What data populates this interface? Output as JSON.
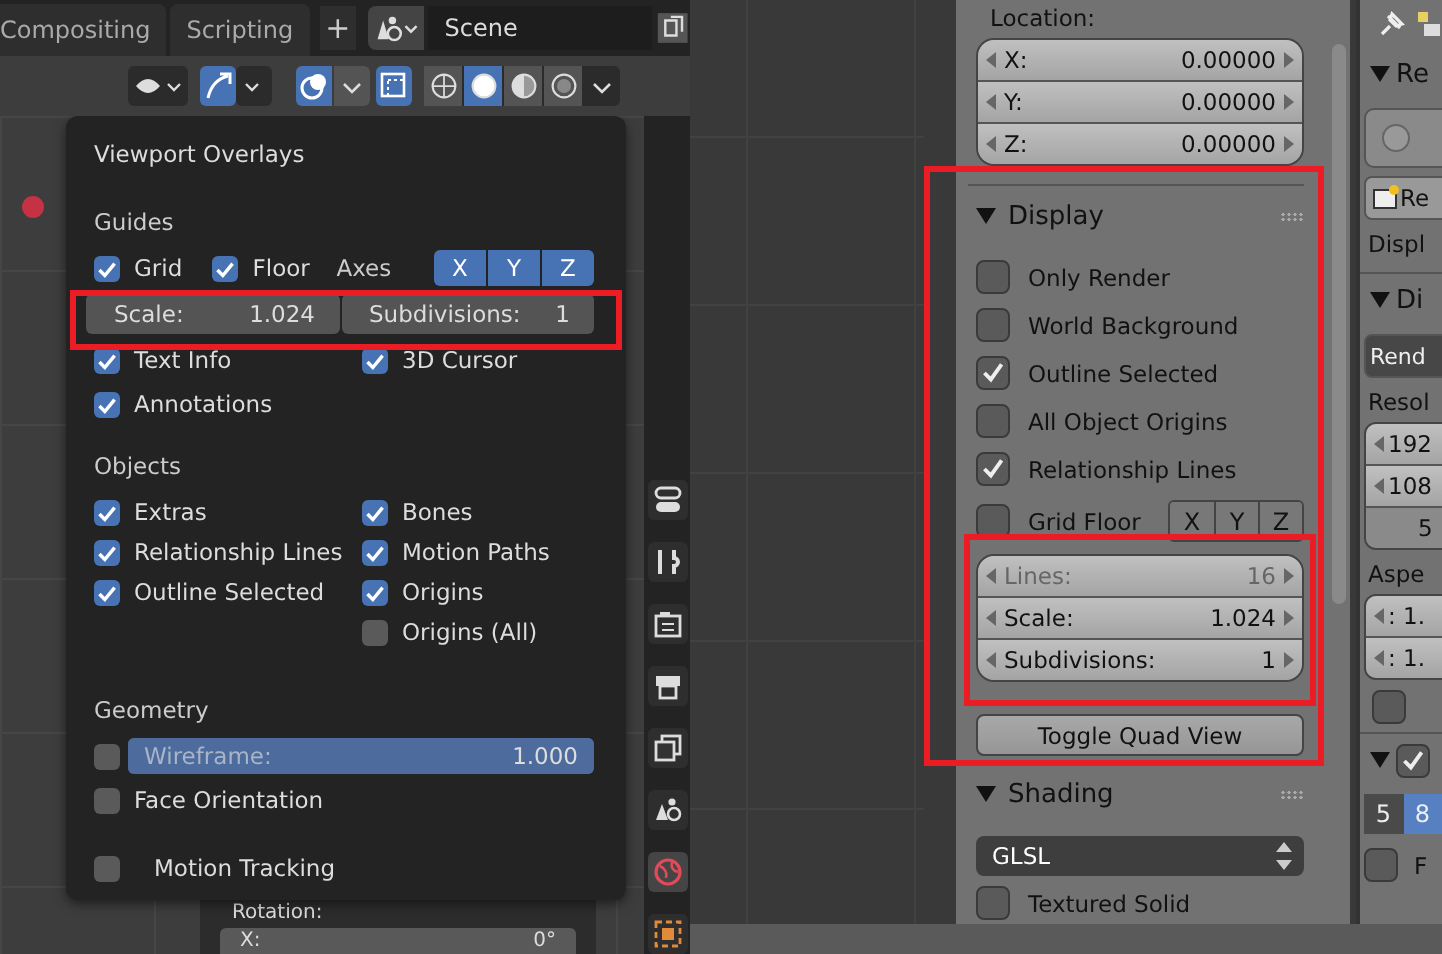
{
  "left": {
    "tabs": [
      {
        "label": "Compositing",
        "selected": false
      },
      {
        "label": "Scripting",
        "selected": false
      }
    ],
    "add_tab": "+",
    "scene": "Scene",
    "overlay_toggle": {
      "on": true
    },
    "shading_modes": [
      {
        "selected": false
      },
      {
        "selected": true
      },
      {
        "selected": false
      },
      {
        "selected": false
      }
    ],
    "sidebar": {
      "rotation_label": "Rotation:",
      "x_label": "X:",
      "x_value": "0°"
    },
    "popup": {
      "title": "Viewport Overlays",
      "guides": {
        "heading": "Guides",
        "grid": {
          "label": "Grid",
          "checked": true
        },
        "floor": {
          "label": "Floor",
          "checked": true
        },
        "axes_label": "Axes",
        "axes": [
          {
            "label": "X",
            "selected": true
          },
          {
            "label": "Y",
            "selected": true
          },
          {
            "label": "Z",
            "selected": true
          }
        ],
        "scale": {
          "label": "Scale:",
          "value": "1.024"
        },
        "subdivisions": {
          "label": "Subdivisions:",
          "value": "1"
        },
        "options": [
          {
            "label": "Text Info",
            "checked": true
          },
          {
            "label": "3D Cursor",
            "checked": true
          },
          {
            "label": "Annotations",
            "checked": true
          }
        ]
      },
      "objects": {
        "heading": "Objects",
        "options": [
          {
            "label": "Extras",
            "checked": true
          },
          {
            "label": "Bones",
            "checked": true
          },
          {
            "label": "Relationship Lines",
            "checked": true
          },
          {
            "label": "Motion Paths",
            "checked": true
          },
          {
            "label": "Outline Selected",
            "checked": true
          },
          {
            "label": "Origins",
            "checked": true
          },
          {
            "label": "Origins (All)",
            "checked": false
          }
        ]
      },
      "geometry": {
        "heading": "Geometry",
        "wireframe": {
          "checked": false,
          "label": "Wireframe:",
          "value": "1.000",
          "level": 1.0
        },
        "face_orientation": {
          "label": "Face Orientation",
          "checked": false
        }
      },
      "motion_tracking": {
        "label": "Motion Tracking",
        "checked": false
      }
    }
  },
  "right": {
    "location": {
      "label": "Location:",
      "fields": [
        {
          "label": "X:",
          "value": "0.00000"
        },
        {
          "label": "Y:",
          "value": "0.00000"
        },
        {
          "label": "Z:",
          "value": "0.00000"
        }
      ]
    },
    "display": {
      "title": "Display",
      "options": [
        {
          "label": "Only Render",
          "checked": false
        },
        {
          "label": "World Background",
          "checked": false
        },
        {
          "label": "Outline Selected",
          "checked": true
        },
        {
          "label": "All Object Origins",
          "checked": false
        },
        {
          "label": "Relationship Lines",
          "checked": true
        }
      ],
      "grid_floor": {
        "label": "Grid Floor",
        "checked": false
      },
      "axes": [
        {
          "label": "X",
          "selected": false
        },
        {
          "label": "Y",
          "selected": false
        },
        {
          "label": "Z",
          "selected": false
        }
      ],
      "fields": [
        {
          "label": "Lines:",
          "value": "16",
          "disabled": true
        },
        {
          "label": "Scale:",
          "value": "1.024",
          "disabled": false
        },
        {
          "label": "Subdivisions:",
          "value": "1",
          "disabled": false
        }
      ],
      "quad_button": "Toggle Quad View"
    },
    "shading": {
      "title": "Shading",
      "mode": "GLSL",
      "textured_solid": {
        "label": "Textured Solid",
        "checked": false
      }
    },
    "properties": {
      "header1": "Re",
      "radio": {
        "on": false
      },
      "button1": "Re",
      "label1": "Displ",
      "header2": "Di",
      "button2": "Rend",
      "label2": "Resol",
      "res_fields": [
        "192",
        "108",
        "5"
      ],
      "label3": "Aspe",
      "aspect_fields": [
        ": 1.",
        ": 1."
      ],
      "checkbox": {
        "checked": false
      },
      "panel_enable": {
        "checked": true
      },
      "samples": [
        {
          "label": "5",
          "selected": false
        },
        {
          "label": "8",
          "selected": true
        }
      ],
      "last_checkbox": {
        "checked": false
      },
      "last_label": "F"
    }
  }
}
